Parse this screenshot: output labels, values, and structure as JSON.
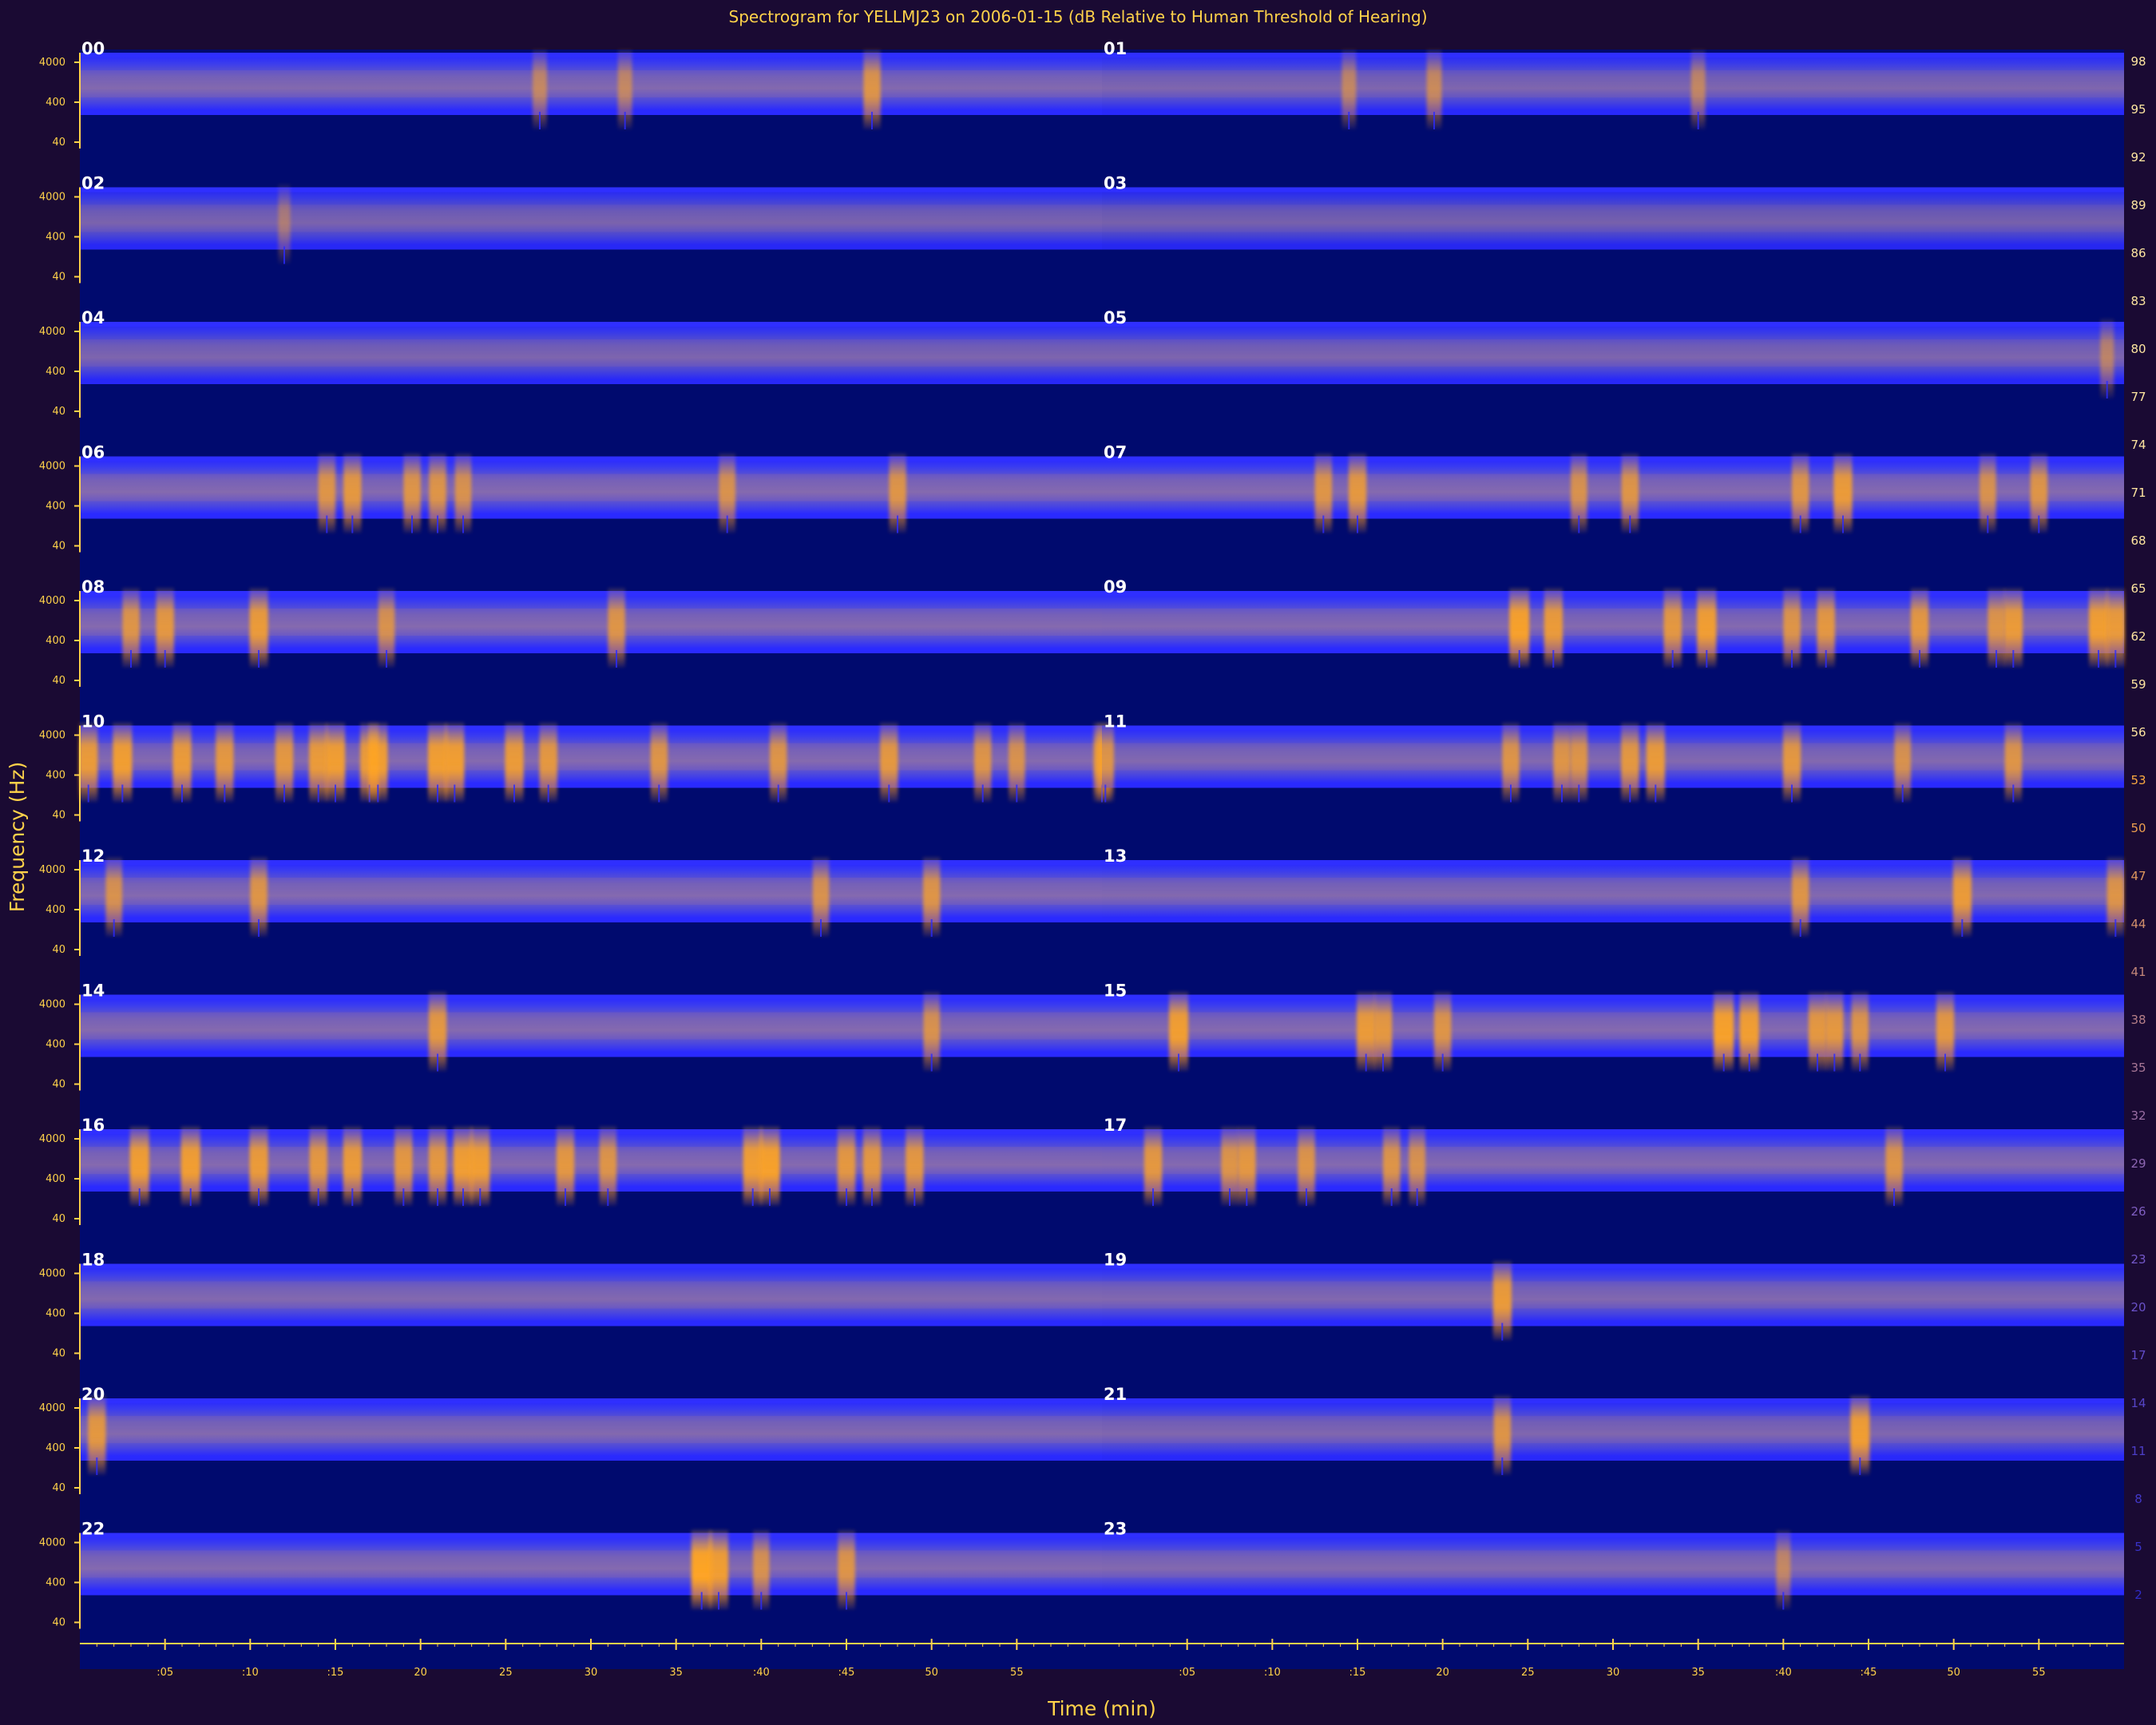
{
  "chart_data": {
    "type": "heatmap",
    "title": "Spectrogram for YELLMJ23 on 2006-01-15 (dB Relative to Human Threshold of Hearing)",
    "xlabel": "Time (min)",
    "ylabel": "Frequency (Hz)",
    "hour_labels": [
      "00",
      "01",
      "02",
      "03",
      "04",
      "05",
      "06",
      "07",
      "08",
      "09",
      "10",
      "11",
      "12",
      "13",
      "14",
      "15",
      "16",
      "17",
      "18",
      "19",
      "20",
      "21",
      "22",
      "23"
    ],
    "x_ticks": [
      ":05",
      ":10",
      ":15",
      "20",
      "25",
      "30",
      "35",
      ":40",
      ":45",
      "50",
      "55"
    ],
    "x_range_min": [
      0,
      60
    ],
    "freq_ticks": [
      "4000",
      "400",
      "40"
    ],
    "colorbar_ticks": [
      98,
      95,
      92,
      89,
      86,
      83,
      80,
      77,
      74,
      71,
      68,
      65,
      62,
      59,
      56,
      53,
      50,
      47,
      44,
      41,
      38,
      35,
      32,
      29,
      26,
      23,
      20,
      17,
      14,
      11,
      8,
      5,
      2
    ],
    "colorbar_range_db": [
      0,
      98
    ],
    "colors": {
      "background": "#1a0a33",
      "quiet": "#000a6e",
      "band": "#2a2aff",
      "loud": "#ffa524",
      "axis": "#ffd24a"
    },
    "panel_activity": [
      {
        "hour": "00",
        "level": 0.48,
        "events": [
          [
            46.5,
            0.75
          ],
          [
            27,
            0.55
          ],
          [
            32,
            0.55
          ]
        ]
      },
      {
        "hour": "01",
        "level": 0.42,
        "events": [
          [
            14.5,
            0.55
          ],
          [
            19.5,
            0.6
          ],
          [
            35,
            0.55
          ]
        ]
      },
      {
        "hour": "02",
        "level": 0.35,
        "events": [
          [
            12,
            0.4
          ]
        ]
      },
      {
        "hour": "03",
        "level": 0.3,
        "events": []
      },
      {
        "hour": "04",
        "level": 0.4,
        "events": []
      },
      {
        "hour": "05",
        "level": 0.4,
        "events": [
          [
            59,
            0.5
          ]
        ]
      },
      {
        "hour": "06",
        "level": 0.55,
        "events": [
          [
            14.5,
            0.75
          ],
          [
            16,
            0.8
          ],
          [
            19.5,
            0.75
          ],
          [
            21,
            0.75
          ],
          [
            22.5,
            0.7
          ],
          [
            38,
            0.7
          ],
          [
            48,
            0.75
          ]
        ]
      },
      {
        "hour": "07",
        "level": 0.55,
        "events": [
          [
            13,
            0.75
          ],
          [
            15,
            0.8
          ],
          [
            28,
            0.7
          ],
          [
            31,
            0.75
          ],
          [
            41,
            0.75
          ],
          [
            43.5,
            0.85
          ],
          [
            52,
            0.7
          ],
          [
            55,
            0.75
          ]
        ]
      },
      {
        "hour": "08",
        "level": 0.55,
        "events": [
          [
            3,
            0.75
          ],
          [
            5,
            0.8
          ],
          [
            10.5,
            0.85
          ],
          [
            18,
            0.7
          ],
          [
            31.5,
            0.75
          ]
        ]
      },
      {
        "hour": "09",
        "level": 0.52,
        "events": [
          [
            24.5,
            0.95
          ],
          [
            26.5,
            0.85
          ],
          [
            33.5,
            0.8
          ],
          [
            35.5,
            0.9
          ],
          [
            40.5,
            0.75
          ],
          [
            42.5,
            0.8
          ],
          [
            48,
            0.8
          ],
          [
            52.5,
            0.75
          ],
          [
            53.5,
            0.85
          ],
          [
            58.5,
            0.9
          ],
          [
            59.5,
            0.85
          ]
        ]
      },
      {
        "hour": "10",
        "level": 0.55,
        "events": [
          [
            0.5,
            0.85
          ],
          [
            2.5,
            0.9
          ],
          [
            6,
            0.85
          ],
          [
            8.5,
            0.8
          ],
          [
            12,
            0.8
          ],
          [
            14,
            0.85
          ],
          [
            15,
            0.9
          ],
          [
            17,
            0.85
          ],
          [
            17.5,
            0.9
          ],
          [
            21,
            0.9
          ],
          [
            22,
            0.9
          ],
          [
            25.5,
            0.85
          ],
          [
            27.5,
            0.8
          ],
          [
            34,
            0.75
          ],
          [
            41,
            0.75
          ],
          [
            47.5,
            0.8
          ],
          [
            53,
            0.75
          ],
          [
            55,
            0.7
          ],
          [
            60,
            0.75
          ]
        ]
      },
      {
        "hour": "11",
        "level": 0.48,
        "events": [
          [
            0.2,
            0.75
          ],
          [
            24,
            0.75
          ],
          [
            27,
            0.75
          ],
          [
            28,
            0.75
          ],
          [
            31,
            0.8
          ],
          [
            32.5,
            0.85
          ],
          [
            40.5,
            0.8
          ],
          [
            47,
            0.7
          ],
          [
            53.5,
            0.75
          ]
        ]
      },
      {
        "hour": "12",
        "level": 0.5,
        "events": [
          [
            2,
            0.7
          ],
          [
            10.5,
            0.75
          ],
          [
            43.5,
            0.7
          ],
          [
            50,
            0.75
          ]
        ]
      },
      {
        "hour": "13",
        "level": 0.48,
        "events": [
          [
            41,
            0.75
          ],
          [
            50.5,
            0.85
          ],
          [
            59.5,
            0.75
          ]
        ]
      },
      {
        "hour": "14",
        "level": 0.55,
        "events": [
          [
            21,
            0.8
          ],
          [
            50,
            0.7
          ]
        ]
      },
      {
        "hour": "15",
        "level": 0.55,
        "events": [
          [
            4.5,
            0.9
          ],
          [
            15.5,
            0.85
          ],
          [
            16.5,
            0.8
          ],
          [
            20,
            0.75
          ],
          [
            36.5,
            0.95
          ],
          [
            38,
            0.9
          ],
          [
            42,
            0.8
          ],
          [
            43,
            0.8
          ],
          [
            44.5,
            0.75
          ],
          [
            49.5,
            0.8
          ]
        ]
      },
      {
        "hour": "16",
        "level": 0.55,
        "events": [
          [
            3.5,
            0.9
          ],
          [
            6.5,
            0.9
          ],
          [
            10.5,
            0.85
          ],
          [
            14,
            0.8
          ],
          [
            16,
            0.85
          ],
          [
            19,
            0.8
          ],
          [
            21,
            0.8
          ],
          [
            22.5,
            0.9
          ],
          [
            23.5,
            0.9
          ],
          [
            28.5,
            0.8
          ],
          [
            31,
            0.75
          ],
          [
            39.5,
            0.9
          ],
          [
            40.5,
            0.95
          ],
          [
            45,
            0.8
          ],
          [
            46.5,
            0.8
          ],
          [
            49,
            0.8
          ]
        ]
      },
      {
        "hour": "17",
        "level": 0.5,
        "events": [
          [
            3,
            0.8
          ],
          [
            7.5,
            0.75
          ],
          [
            8.5,
            0.8
          ],
          [
            12,
            0.75
          ],
          [
            17,
            0.75
          ],
          [
            18.5,
            0.7
          ],
          [
            46.5,
            0.75
          ]
        ]
      },
      {
        "hour": "18",
        "level": 0.48,
        "events": []
      },
      {
        "hour": "19",
        "level": 0.46,
        "events": [
          [
            23.5,
            0.85
          ]
        ]
      },
      {
        "hour": "20",
        "level": 0.48,
        "events": [
          [
            1,
            0.8
          ]
        ]
      },
      {
        "hour": "21",
        "level": 0.45,
        "events": [
          [
            23.5,
            0.75
          ],
          [
            44.5,
            0.9
          ]
        ]
      },
      {
        "hour": "22",
        "level": 0.52,
        "events": [
          [
            36.5,
            1.0
          ],
          [
            37.5,
            0.9
          ],
          [
            40,
            0.7
          ],
          [
            45,
            0.75
          ]
        ]
      },
      {
        "hour": "23",
        "level": 0.48,
        "events": [
          [
            40,
            0.55
          ]
        ]
      }
    ]
  }
}
